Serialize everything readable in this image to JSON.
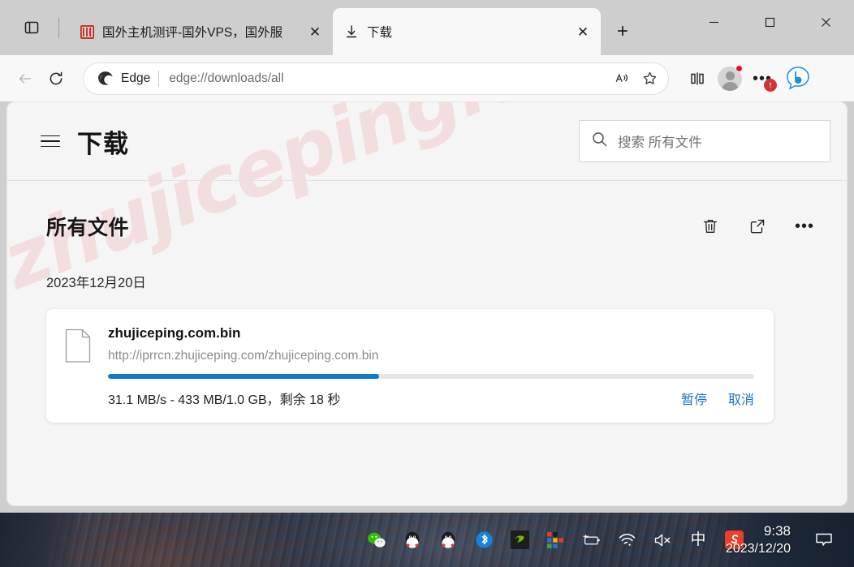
{
  "browser": {
    "tabs": [
      {
        "title": "国外主机测评-国外VPS，国外服",
        "favicon": "red-seal-favicon",
        "active": false
      },
      {
        "title": "下载",
        "favicon": "download-arrow-icon",
        "active": true
      }
    ],
    "newtab_label": "+",
    "tab_close_label": "✕",
    "window_controls": {
      "minimize": "—",
      "maximize": "▢",
      "close": "✕"
    },
    "toolbar": {
      "back_icon": "back-arrow-icon",
      "refresh_icon": "refresh-icon",
      "brand": "Edge",
      "url_prefix": "edge://",
      "url_main": "downloads",
      "url_suffix": "/all",
      "url_full": "edge://downloads/all",
      "read_aloud_icon": "read-aloud-icon",
      "favorite_icon": "star-icon",
      "split_screen_icon": "split-screen-icon",
      "profile_icon": "profile-avatar-icon",
      "settings_icon": "more-horizontal-icon",
      "settings_badge": "↑",
      "copilot_icon": "bing-copilot-icon"
    }
  },
  "downloads_page": {
    "menu_icon": "hamburger-menu-icon",
    "title": "下载",
    "search": {
      "icon": "search-icon",
      "placeholder": "搜索 所有文件",
      "value": ""
    },
    "section_title": "所有文件",
    "actions": [
      {
        "name": "delete-all",
        "icon": "trash-icon",
        "label": "🗑"
      },
      {
        "name": "open-folder",
        "icon": "open-external-icon",
        "label": "↗"
      },
      {
        "name": "more-options",
        "icon": "more-horizontal-icon",
        "label": "•••"
      }
    ],
    "date_group": "2023年12月20日",
    "download": {
      "file_icon": "document-file-icon",
      "filename": "zhujiceping.com.bin",
      "url": "http://iprrcn.zhujiceping.com/zhujiceping.com.bin",
      "progress_percent": 42,
      "status": "31.1 MB/s - 433 MB/1.0 GB，剩余 18 秒",
      "speed": "31.1 MB/s",
      "downloaded": "433 MB",
      "total_size": "1.0 GB",
      "time_remaining": "剩余 18 秒",
      "pause_label": "暂停",
      "cancel_label": "取消"
    },
    "watermark": "zhujiceping.com"
  },
  "taskbar": {
    "tray_icons": [
      {
        "name": "wechat-icon"
      },
      {
        "name": "qq-icon-1"
      },
      {
        "name": "qq-icon-2"
      },
      {
        "name": "bluetooth-icon"
      },
      {
        "name": "nvidia-icon"
      },
      {
        "name": "app-grid-icon"
      },
      {
        "name": "battery-charging-icon"
      },
      {
        "name": "wifi-icon"
      },
      {
        "name": "volume-muted-icon"
      },
      {
        "name": "ime-chinese-icon",
        "label": "中"
      },
      {
        "name": "sogou-input-icon",
        "label": "S"
      }
    ],
    "clock_time": "9:38",
    "clock_date": "2023/12/20",
    "notification_icon": "notification-bubble-icon"
  },
  "colors": {
    "accent_blue": "#0f77d0",
    "link_blue": "#1a73c8",
    "badge_red": "#d13438",
    "watermark_red": "#e45252"
  }
}
